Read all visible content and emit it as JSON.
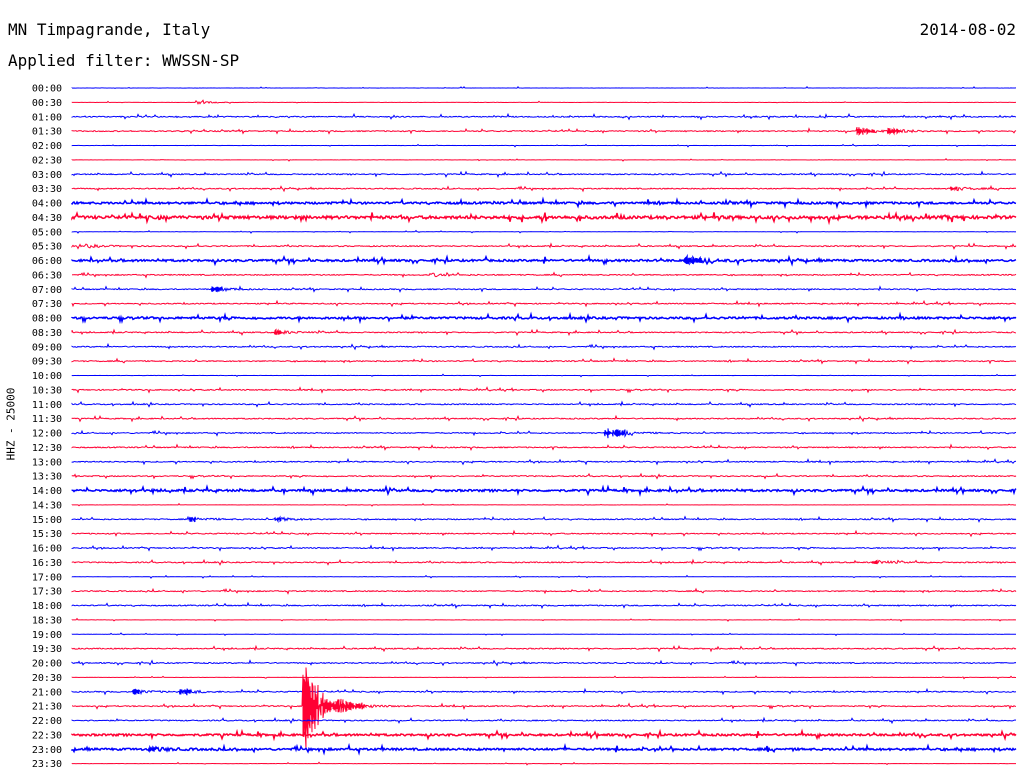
{
  "header": {
    "station": "MN Timpagrande, Italy",
    "date": "2014-08-02",
    "filter": "Applied filter: WWSSN-SP"
  },
  "ylabel": "HHZ - 25000",
  "colors": {
    "odd_trace": "#0000ff",
    "even_trace": "#ff0033"
  },
  "chart_data": {
    "type": "line",
    "title": "MN Timpagrande, Italy",
    "subtitle": "Applied filter: WWSSN-SP",
    "ylabel": "HHZ - 25000",
    "tick_labels": [
      "00:00",
      "00:30",
      "01:00",
      "01:30",
      "02:00",
      "02:30",
      "03:00",
      "03:30",
      "04:00",
      "04:30",
      "05:00",
      "05:30",
      "06:00",
      "06:30",
      "07:00",
      "07:30",
      "08:00",
      "08:30",
      "09:00",
      "09:30",
      "10:00",
      "10:30",
      "11:00",
      "11:30",
      "12:00",
      "12:30",
      "13:00",
      "13:30",
      "14:00",
      "14:30",
      "15:00",
      "15:30",
      "16:00",
      "16:30",
      "17:00",
      "17:30",
      "18:00",
      "18:30",
      "19:00",
      "19:30",
      "20:00",
      "20:30",
      "21:00",
      "21:30",
      "22:00",
      "22:30",
      "23:00",
      "23:30"
    ],
    "series_colors": [
      "#0000ff",
      "#ff0033"
    ],
    "noise_level": [
      0,
      0,
      1,
      1,
      0,
      0,
      1,
      1,
      2,
      3,
      0,
      1,
      2,
      1,
      1,
      1,
      2,
      1,
      1,
      1,
      0,
      1,
      1,
      1,
      1,
      1,
      1,
      1,
      2,
      0,
      1,
      1,
      1,
      1,
      0,
      1,
      1,
      0,
      0,
      1,
      1,
      0,
      1,
      1,
      1,
      2,
      2,
      0
    ],
    "events": [
      {
        "trace": "00:30",
        "minute": 4.0,
        "amplitude": 1.5
      },
      {
        "trace": "01:30",
        "minute": 25.0,
        "amplitude": 4.0
      },
      {
        "trace": "01:30",
        "minute": 26.0,
        "amplitude": 3.0
      },
      {
        "trace": "03:30",
        "minute": 28.0,
        "amplitude": 2.0
      },
      {
        "trace": "05:30",
        "minute": 0.5,
        "amplitude": 1.5
      },
      {
        "trace": "06:00",
        "minute": 19.5,
        "amplitude": 4.0
      },
      {
        "trace": "06:30",
        "minute": 11.5,
        "amplitude": 1.5
      },
      {
        "trace": "07:00",
        "minute": 4.5,
        "amplitude": 2.5
      },
      {
        "trace": "08:30",
        "minute": 6.5,
        "amplitude": 2.0
      },
      {
        "trace": "12:00",
        "minute": 17.0,
        "amplitude": 5.0
      },
      {
        "trace": "15:00",
        "minute": 3.8,
        "amplitude": 2.0
      },
      {
        "trace": "15:00",
        "minute": 6.5,
        "amplitude": 2.0
      },
      {
        "trace": "16:30",
        "minute": 25.5,
        "amplitude": 2.0
      },
      {
        "trace": "21:00",
        "minute": 2.0,
        "amplitude": 2.0
      },
      {
        "trace": "21:00",
        "minute": 3.5,
        "amplitude": 2.5
      },
      {
        "trace": "21:30",
        "minute": 7.4,
        "amplitude": 70.0
      },
      {
        "trace": "21:30",
        "minute": 7.9,
        "amplitude": 12.0
      },
      {
        "trace": "21:30",
        "minute": 8.4,
        "amplitude": 10.0
      },
      {
        "trace": "23:00",
        "minute": 2.5,
        "amplitude": 2.0
      }
    ]
  }
}
